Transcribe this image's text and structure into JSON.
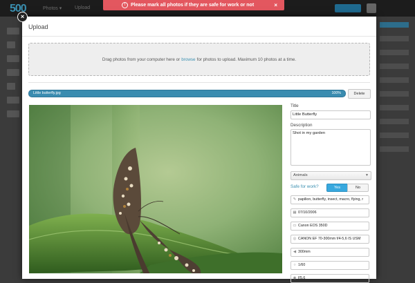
{
  "alert": {
    "text": "Please mark all photos if they are safe for work or not",
    "close": "×",
    "icon": "!"
  },
  "background": {
    "logo": "500",
    "menu_photos": "Photos ▾",
    "menu_upload": "Upload"
  },
  "modal": {
    "title": "Upload",
    "close_icon": "×",
    "dropzone": {
      "text_before": "Drag photos from your computer here or",
      "link": "browse",
      "text_after": "for photos to upload. Maximum 10 photos at a time."
    },
    "upload": {
      "filename": "Little butterfly.jpg",
      "percent": "100%",
      "progress_fraction": 1.0,
      "delete_label": "Delete"
    },
    "form": {
      "title_label": "Title",
      "title_value": "Little Butterfly",
      "description_label": "Description",
      "description_value": "Shot in my garden",
      "category": "Animals",
      "sfw_label": "Safe for work?",
      "sfw_yes": "Yes",
      "sfw_no": "No",
      "tags": "papilion, butterfly, insect, macro, flying, r",
      "date": "07/10/2006",
      "camera": "Canon EOS 350D",
      "lens": "CANON EF 70-300mm f/4-5,6 IS USM",
      "focal_length": "300mm",
      "shutter": "1/60",
      "aperture": "f/5.6"
    }
  },
  "colors": {
    "accent": "#3a8fb0",
    "alert": "#e3575f",
    "yes_button": "#38a8de"
  }
}
